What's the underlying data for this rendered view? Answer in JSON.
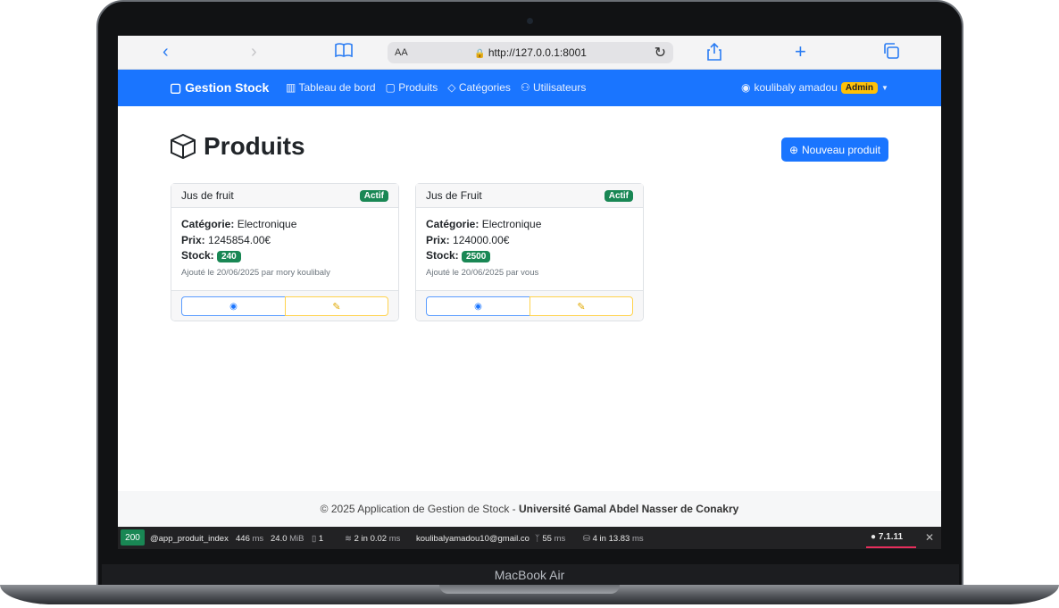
{
  "browser": {
    "back_icon": "‹",
    "forward_icon": "›",
    "book_icon": "📖",
    "aa_label": "AA",
    "url": "http://127.0.0.1:8001",
    "reload_icon": "↻",
    "share_icon": "⇪",
    "new_tab_icon": "+",
    "tabs_icon": "⧉"
  },
  "navbar": {
    "brand": "Gestion Stock",
    "links": [
      "Tableau de bord",
      "Produits",
      "Catégories",
      "Utilisateurs"
    ],
    "user": "koulibaly amadou",
    "role": "Admin"
  },
  "page": {
    "title": "Produits",
    "new_button": "Nouveau produit"
  },
  "products": [
    {
      "name": "Jus de fruit",
      "status": "Actif",
      "category_label": "Catégorie:",
      "category": "Electronique",
      "price_label": "Prix:",
      "price": "1245854.00€",
      "stock_label": "Stock:",
      "stock": "240",
      "added": "Ajouté le 20/06/2025 par mory koulibaly"
    },
    {
      "name": "Jus de Fruit",
      "status": "Actif",
      "category_label": "Catégorie:",
      "category": "Electronique",
      "price_label": "Prix:",
      "price": "124000.00€",
      "stock_label": "Stock:",
      "stock": "2500",
      "added": "Ajouté le 20/06/2025 par vous"
    }
  ],
  "footer": {
    "text": "© 2025 Application de Gestion de Stock - ",
    "university": "Université Gamal Abdel Nasser de Conakry"
  },
  "debug": {
    "status": "200",
    "route": "@app_produit_index",
    "time": "446",
    "time_unit": "ms",
    "memory": "24.0",
    "memory_unit": "MiB",
    "requests": "1",
    "cache": "2 in 0.02",
    "cache_unit": "ms",
    "user": "koulibalyamadou10@gmail.co",
    "twig": "55",
    "twig_unit": "ms",
    "db": "4 in 13.83",
    "db_unit": "ms",
    "version": "7.1.11",
    "close": "✕"
  },
  "device": {
    "name": "MacBook Air"
  }
}
